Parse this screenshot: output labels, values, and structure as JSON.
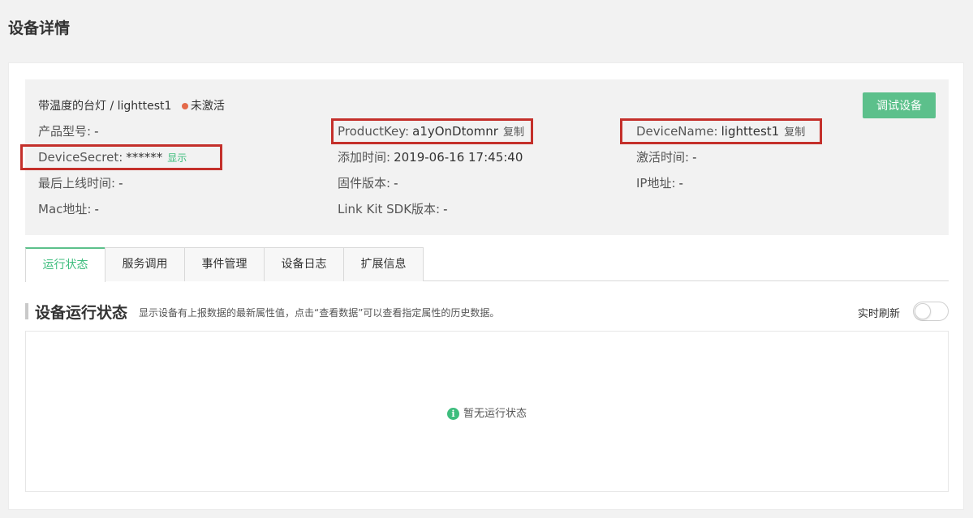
{
  "page": {
    "title": "设备详情"
  },
  "device": {
    "product_name": "带温度的台灯",
    "separator": "/",
    "device_name": "lighttest1",
    "status": "未激活",
    "status_color": "#e46a4a"
  },
  "debug_button": "调试设备",
  "info": {
    "product_model": {
      "label": "产品型号:",
      "value": "-"
    },
    "product_key": {
      "label": "ProductKey:",
      "value": "a1yOnDtomnr",
      "action": "复制"
    },
    "device_name": {
      "label": "DeviceName:",
      "value": "lighttest1",
      "action": "复制"
    },
    "device_secret": {
      "label": "DeviceSecret:",
      "value": "******",
      "action": "显示"
    },
    "add_time": {
      "label": "添加时间:",
      "value": "2019-06-16 17:45:40"
    },
    "activate_time": {
      "label": "激活时间:",
      "value": "-"
    },
    "last_online": {
      "label": "最后上线时间:",
      "value": "-"
    },
    "firmware": {
      "label": "固件版本:",
      "value": "-"
    },
    "ip": {
      "label": "IP地址:",
      "value": "-"
    },
    "mac": {
      "label": "Mac地址:",
      "value": "-"
    },
    "sdk": {
      "label": "Link Kit SDK版本:",
      "value": "-"
    }
  },
  "tabs": [
    {
      "label": "运行状态",
      "active": true
    },
    {
      "label": "服务调用",
      "active": false
    },
    {
      "label": "事件管理",
      "active": false
    },
    {
      "label": "设备日志",
      "active": false
    },
    {
      "label": "扩展信息",
      "active": false
    }
  ],
  "section": {
    "title": "设备运行状态",
    "description": "显示设备有上报数据的最新属性值，点击“查看数据”可以查看指定属性的历史数据。",
    "realtime_label": "实时刷新",
    "realtime_on": false
  },
  "empty": {
    "message": "暂无运行状态"
  },
  "colors": {
    "accent": "#5cc08b",
    "highlight": "#c4302b"
  }
}
